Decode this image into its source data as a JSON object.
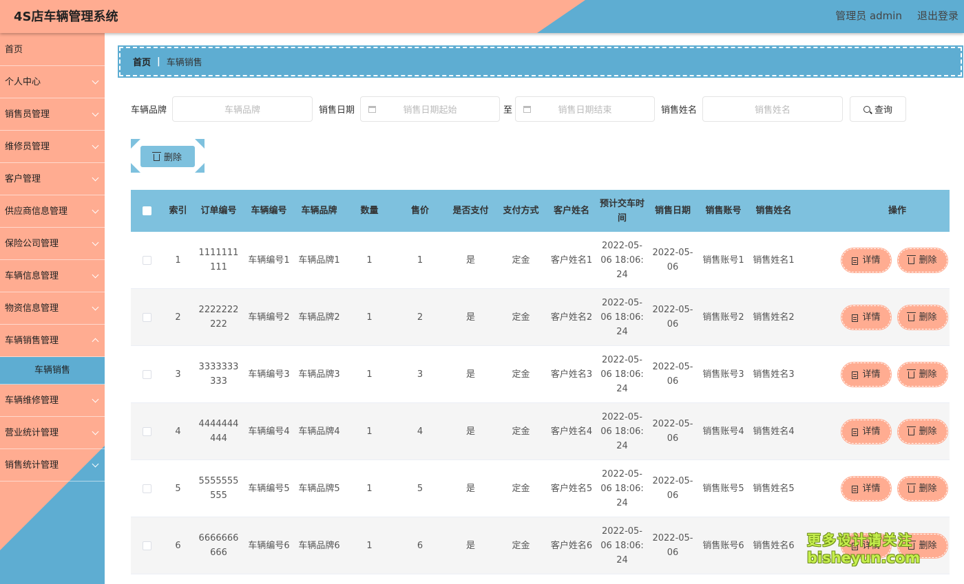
{
  "header": {
    "title": "4S店车辆管理系统",
    "user_label": "管理员 admin",
    "logout_label": "退出登录"
  },
  "sidebar": {
    "items": [
      {
        "label": "首页",
        "expandable": false
      },
      {
        "label": "个人中心",
        "expandable": true
      },
      {
        "label": "销售员管理",
        "expandable": true
      },
      {
        "label": "维修员管理",
        "expandable": true
      },
      {
        "label": "客户管理",
        "expandable": true
      },
      {
        "label": "供应商信息管理",
        "expandable": true
      },
      {
        "label": "保险公司管理",
        "expandable": true
      },
      {
        "label": "车辆信息管理",
        "expandable": true
      },
      {
        "label": "物资信息管理",
        "expandable": true
      },
      {
        "label": "车辆销售管理",
        "expandable": true,
        "open": true,
        "subitem": "车辆销售"
      },
      {
        "label": "车辆维修管理",
        "expandable": true
      },
      {
        "label": "营业统计管理",
        "expandable": true
      },
      {
        "label": "销售统计管理",
        "expandable": true
      }
    ]
  },
  "breadcrumb": {
    "home": "首页",
    "separator": "|",
    "current": "车辆销售"
  },
  "search": {
    "brand_label": "车辆品牌",
    "brand_placeholder": "车辆品牌",
    "date_label": "销售日期",
    "date_start_placeholder": "销售日期起始",
    "date_to": "至",
    "date_end_placeholder": "销售日期结束",
    "seller_label": "销售姓名",
    "seller_placeholder": "销售姓名",
    "query_label": "查询"
  },
  "bulk_delete_label": "删除",
  "table": {
    "headers": [
      "索引",
      "订单编号",
      "车辆编号",
      "车辆品牌",
      "数量",
      "售价",
      "是否支付",
      "支付方式",
      "客户姓名",
      "预计交车时间",
      "销售日期",
      "销售账号",
      "销售姓名",
      "操作"
    ],
    "detail_label": "详情",
    "delete_label": "删除",
    "rows": [
      {
        "idx": "1",
        "order": "1111111111",
        "car_no": "车辆编号1",
        "brand": "车辆品牌1",
        "qty": "1",
        "price": "1",
        "paid": "是",
        "method": "定金",
        "customer": "客户姓名1",
        "delivery": "2022-05-06 18:06:24",
        "date": "2022-05-06",
        "account": "销售账号1",
        "seller": "销售姓名1"
      },
      {
        "idx": "2",
        "order": "2222222222",
        "car_no": "车辆编号2",
        "brand": "车辆品牌2",
        "qty": "1",
        "price": "2",
        "paid": "是",
        "method": "定金",
        "customer": "客户姓名2",
        "delivery": "2022-05-06 18:06:24",
        "date": "2022-05-06",
        "account": "销售账号2",
        "seller": "销售姓名2"
      },
      {
        "idx": "3",
        "order": "3333333333",
        "car_no": "车辆编号3",
        "brand": "车辆品牌3",
        "qty": "1",
        "price": "3",
        "paid": "是",
        "method": "定金",
        "customer": "客户姓名3",
        "delivery": "2022-05-06 18:06:24",
        "date": "2022-05-06",
        "account": "销售账号3",
        "seller": "销售姓名3"
      },
      {
        "idx": "4",
        "order": "4444444444",
        "car_no": "车辆编号4",
        "brand": "车辆品牌4",
        "qty": "1",
        "price": "4",
        "paid": "是",
        "method": "定金",
        "customer": "客户姓名4",
        "delivery": "2022-05-06 18:06:24",
        "date": "2022-05-06",
        "account": "销售账号4",
        "seller": "销售姓名4"
      },
      {
        "idx": "5",
        "order": "5555555555",
        "car_no": "车辆编号5",
        "brand": "车辆品牌5",
        "qty": "1",
        "price": "5",
        "paid": "是",
        "method": "定金",
        "customer": "客户姓名5",
        "delivery": "2022-05-06 18:06:24",
        "date": "2022-05-06",
        "account": "销售账号5",
        "seller": "销售姓名5"
      },
      {
        "idx": "6",
        "order": "6666666666",
        "car_no": "车辆编号6",
        "brand": "车辆品牌6",
        "qty": "1",
        "price": "6",
        "paid": "是",
        "method": "定金",
        "customer": "客户姓名6",
        "delivery": "2022-05-06 18:06:24",
        "date": "2022-05-06",
        "account": "销售账号6",
        "seller": "销售姓名6"
      }
    ]
  },
  "watermark": {
    "line1": "更多设计请关注",
    "line2": "bisheyun.com"
  },
  "colors": {
    "accent_orange": "#ffac91",
    "accent_blue": "#5eadd2",
    "table_header": "#7ec1de"
  }
}
